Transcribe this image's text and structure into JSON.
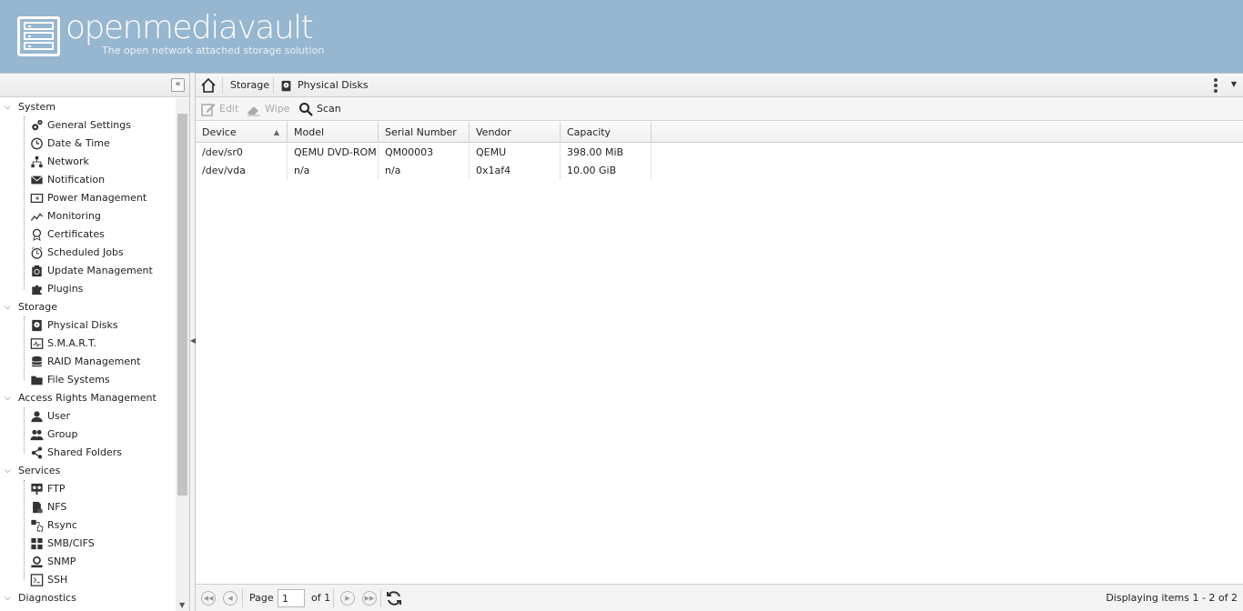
{
  "header": {
    "brand": "openmediavault",
    "tagline": "The open network attached storage solution"
  },
  "sidebar": {
    "collapse_glyph": "«",
    "groups": [
      {
        "label": "System",
        "items": [
          {
            "label": "General Settings",
            "icon": "gears-icon"
          },
          {
            "label": "Date & Time",
            "icon": "clock-icon"
          },
          {
            "label": "Network",
            "icon": "network-icon"
          },
          {
            "label": "Notification",
            "icon": "envelope-icon"
          },
          {
            "label": "Power Management",
            "icon": "power-icon"
          },
          {
            "label": "Monitoring",
            "icon": "line-chart-icon"
          },
          {
            "label": "Certificates",
            "icon": "certificate-icon"
          },
          {
            "label": "Scheduled Jobs",
            "icon": "alarm-clock-icon"
          },
          {
            "label": "Update Management",
            "icon": "update-icon"
          },
          {
            "label": "Plugins",
            "icon": "puzzle-icon"
          }
        ]
      },
      {
        "label": "Storage",
        "items": [
          {
            "label": "Physical Disks",
            "icon": "disk-icon"
          },
          {
            "label": "S.M.A.R.T.",
            "icon": "smart-icon"
          },
          {
            "label": "RAID Management",
            "icon": "database-icon"
          },
          {
            "label": "File Systems",
            "icon": "folder-icon"
          }
        ]
      },
      {
        "label": "Access Rights Management",
        "items": [
          {
            "label": "User",
            "icon": "user-icon"
          },
          {
            "label": "Group",
            "icon": "group-icon"
          },
          {
            "label": "Shared Folders",
            "icon": "share-icon"
          }
        ]
      },
      {
        "label": "Services",
        "items": [
          {
            "label": "FTP",
            "icon": "ftp-icon"
          },
          {
            "label": "NFS",
            "icon": "nfs-icon"
          },
          {
            "label": "Rsync",
            "icon": "rsync-icon"
          },
          {
            "label": "SMB/CIFS",
            "icon": "windows-icon"
          },
          {
            "label": "SNMP",
            "icon": "snmp-icon"
          },
          {
            "label": "SSH",
            "icon": "terminal-icon"
          }
        ]
      },
      {
        "label": "Diagnostics",
        "items": []
      }
    ]
  },
  "breadcrumb": {
    "items": [
      "Storage",
      "Physical Disks"
    ]
  },
  "toolbar": {
    "edit": "Edit",
    "wipe": "Wipe",
    "scan": "Scan"
  },
  "grid": {
    "columns": [
      "Device",
      "Model",
      "Serial Number",
      "Vendor",
      "Capacity"
    ],
    "rows": [
      [
        "/dev/sr0",
        "QEMU DVD-ROM",
        "QM00003",
        "QEMU",
        "398.00 MiB"
      ],
      [
        "/dev/vda",
        "n/a",
        "n/a",
        "0x1af4",
        "10.00 GiB"
      ]
    ]
  },
  "pager": {
    "page_label": "Page",
    "page_value": "1",
    "of_label": "of 1",
    "info": "Displaying items 1 - 2 of 2"
  },
  "colors": {
    "header_bg": "#97b6d0",
    "accent": "#ffffff"
  }
}
